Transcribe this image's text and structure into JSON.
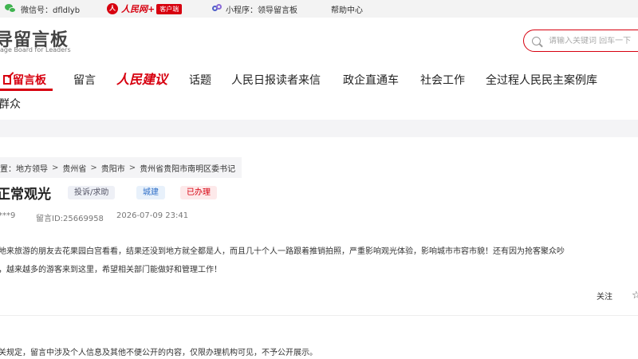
{
  "topbar": {
    "wechat_label": "微信号：dfldlyb",
    "rmw_brand": "人民网+",
    "client_badge": "客户端",
    "miniprogram_label": "小程序：领导留言板",
    "help_label": "帮助中心"
  },
  "header": {
    "logo_title": "导留言板",
    "logo_subtitle": "age Board for Leaders",
    "search_placeholder": "请输入关键词 回车一下"
  },
  "nav": {
    "items": [
      "留言板",
      "留言",
      "人民建议",
      "话题",
      "人民日报读者来信",
      "政企直通车",
      "社会工作",
      "全过程人民民主案例库"
    ],
    "row2": "群众"
  },
  "breadcrumb": {
    "prefix": "置：",
    "items": [
      "地方领导",
      "贵州省",
      "贵阳市",
      "贵州省贵阳市南明区委书记"
    ],
    "separator": ">"
  },
  "message": {
    "title": "正常观光",
    "tags": {
      "type": "投诉/求助",
      "field": "城建",
      "status": "已办理"
    },
    "author": "***9",
    "id_label": "留言ID:25669958",
    "datetime": "2026-07-09 23:41",
    "content_line1": "地来旅游的朋友去花果园白宫看看，结果还没到地方就全都是人，而且几十个人一路跟着推销拍照，严重影响观光体验，影响城市市容市貌！还有因为抢客聚众吵",
    "content_line2": "，越来越多的游客来到这里，希望相关部门能做好和管理工作！",
    "follow_label": "关注"
  },
  "notice": "关规定，留言中涉及个人信息及其他不便公开的内容，仅限办理机构可见，不予公开展示。",
  "colors": {
    "brand_red": "#d7000f",
    "wechat_green": "#3fb34f",
    "band_gray": "#f4f4f6"
  }
}
